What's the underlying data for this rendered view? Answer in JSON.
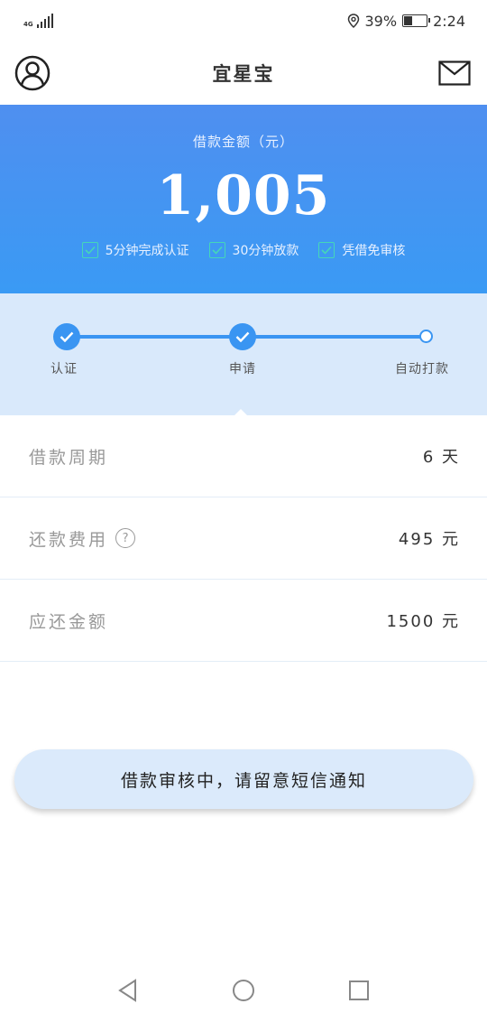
{
  "status_bar": {
    "network": "4G",
    "battery_text": "39%",
    "battery_level": 0.39,
    "time": "2:24"
  },
  "header": {
    "title": "宜星宝",
    "left_icon": "user-avatar-icon",
    "right_icon": "mail-icon"
  },
  "banner": {
    "label": "借款金额（元）",
    "amount": "1,005",
    "features": [
      {
        "text": "5分钟完成认证",
        "icon": "checkbox-icon"
      },
      {
        "text": "30分钟放款",
        "icon": "checkbox-icon"
      },
      {
        "text": "凭借免审核",
        "icon": "checkbox-icon"
      }
    ]
  },
  "progress": {
    "steps": [
      {
        "label": "认证",
        "done": true
      },
      {
        "label": "申请",
        "done": true
      },
      {
        "label": "自动打款",
        "done": false
      }
    ]
  },
  "details": [
    {
      "label": "借款周期",
      "value": "6 天",
      "help": false
    },
    {
      "label": "还款费用",
      "value": "495 元",
      "help": true,
      "help_symbol": "?"
    },
    {
      "label": "应还金额",
      "value": "1500 元",
      "help": false
    }
  ],
  "status_button": {
    "label": "借款审核中，请留意短信通知"
  },
  "colors": {
    "brand_blue": "#3a95f2",
    "banner_top": "#4f8ff0",
    "check_green": "#45d7b8",
    "progress_bg": "#d9e9fb",
    "button_bg": "#dbeafb"
  },
  "nav": {
    "back_icon": "back-triangle-icon",
    "home_icon": "home-circle-icon",
    "recents_icon": "recents-square-icon"
  }
}
